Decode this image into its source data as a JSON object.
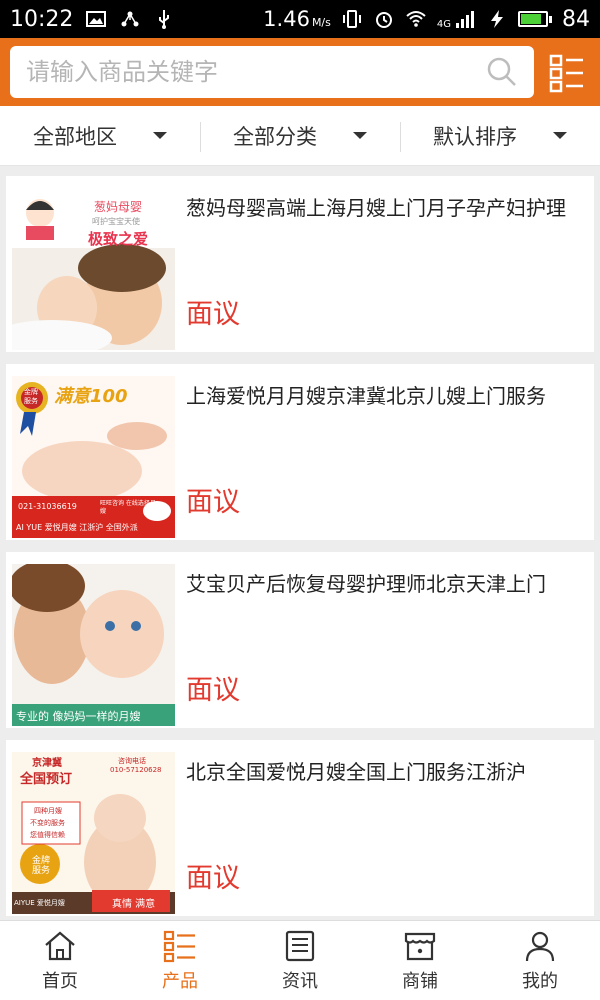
{
  "statusbar": {
    "time": "10:22",
    "speed": "1.46",
    "speed_unit": "M/s",
    "network": "4G",
    "battery": "84",
    "battery_fraction": 0.84
  },
  "search": {
    "placeholder": "请输入商品关键字"
  },
  "filters": [
    {
      "label": "全部地区"
    },
    {
      "label": "全部分类"
    },
    {
      "label": "默认排序"
    }
  ],
  "products": [
    {
      "title": "葱妈母婴高端上海月嫂上门月子孕产妇护理",
      "price": "面议",
      "thumb": {
        "brand": "葱妈母婴",
        "tagline": "极致之爱",
        "sub": "呵护宝宝天使"
      }
    },
    {
      "title": "上海爱悦月月嫂京津冀北京儿嫂上门服务",
      "price": "面议",
      "thumb": {
        "badge": "金牌服务",
        "headline": "满意100",
        "phone": "021-31036619",
        "consult": "旺旺咨询 在线选择月嫂",
        "footer": "AI YUE 爱悦月嫂  江浙沪 全国外派"
      }
    },
    {
      "title": "艾宝贝产后恢复母婴护理师北京天津上门",
      "price": "面议",
      "thumb": {
        "footer": "专业的 像妈妈一样的月嫂"
      }
    },
    {
      "title": "北京全国爱悦月嫂全国上门服务江浙沪",
      "price": "面议",
      "thumb": {
        "region": "京津冀",
        "headline": "全国预订",
        "hotline_label": "咨询电话",
        "hotline": "010-57120628",
        "points": [
          "四种月嫂",
          "不变的服务",
          "您值得信赖"
        ],
        "seal": "金牌服务",
        "slogan": "真情 满意",
        "brand": "AIYUE 爱悦月嫂"
      }
    }
  ],
  "bottomnav": [
    {
      "label": "首页",
      "icon": "home-icon"
    },
    {
      "label": "产品",
      "icon": "product-list-icon"
    },
    {
      "label": "资讯",
      "icon": "news-icon"
    },
    {
      "label": "商铺",
      "icon": "shop-icon"
    },
    {
      "label": "我的",
      "icon": "user-icon"
    }
  ],
  "colors": {
    "accent": "#e8701a",
    "price": "#e23a2f"
  }
}
